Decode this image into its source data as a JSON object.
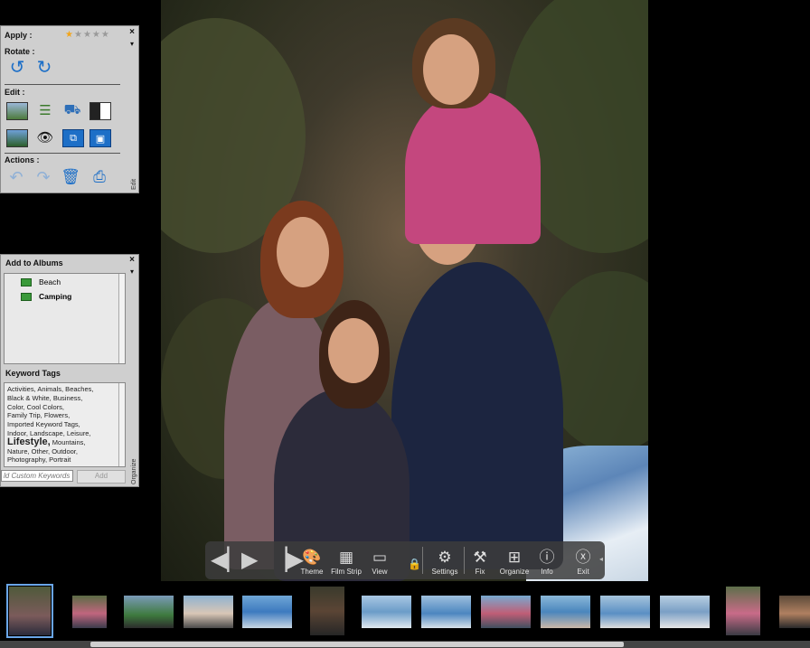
{
  "edit_panel": {
    "apply_label": "Apply :",
    "rating": 1,
    "rating_max": 5,
    "close": "×",
    "rotate_label": "Rotate :",
    "edit_label": "Edit :",
    "actions_label": "Actions :",
    "side_label": "Edit"
  },
  "organize_panel": {
    "albums_title": "Add to Albums",
    "close": "×",
    "albums": [
      {
        "name": "Beach",
        "bold": false
      },
      {
        "name": "Camping",
        "bold": true
      }
    ],
    "keywords_title": "Keyword Tags",
    "keywords_lines": [
      "Activities,   Animals,   Beaches,",
      "Black & White,   Business,",
      "Color,   Cool Colors,",
      "Family Trip,   Flowers,",
      "Imported Keyword Tags,",
      "Indoor,   Landscape,   Leisure,"
    ],
    "keyword_big": "Lifestyle,",
    "keywords_after_big": " Mountains,",
    "keywords_lines2": [
      "Nature,   Other,   Outdoor,",
      "Photography,   Portrait"
    ],
    "input_placeholder": "ld Custom Keywords",
    "add_label": "Add",
    "side_label": "Organize"
  },
  "controls": {
    "theme": "Theme",
    "film_strip": "Film Strip",
    "view": "View",
    "settings": "Settings",
    "fix": "Fix",
    "organize": "Organize",
    "info": "Info",
    "exit": "Exit"
  },
  "colors": {
    "panel_bg": "#cfcfcf",
    "accent_blue": "#1d6fc7",
    "star_on": "#f2a51a",
    "selection": "#6aa6e8"
  },
  "filmstrip": {
    "count": 14,
    "selected_index": 0
  }
}
